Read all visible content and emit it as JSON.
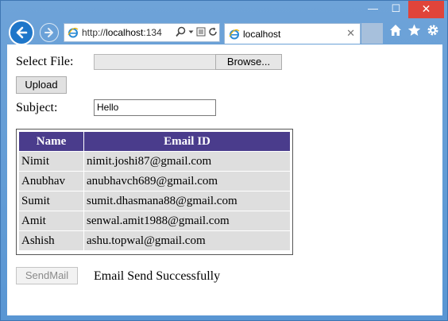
{
  "window": {
    "min_glyph": "—",
    "max_glyph": "☐",
    "close_glyph": "✕"
  },
  "browser": {
    "address_prefix": "http://",
    "address_host": "localhost",
    "address_rest": ":134",
    "tab_title": "localhost",
    "tab_close_glyph": "✕",
    "icons": [
      "back-arrow-icon",
      "forward-arrow-icon",
      "ie-logo-icon",
      "search-icon",
      "dropdown-icon",
      "compatibility-icon",
      "refresh-icon",
      "home-icon",
      "favorites-star-icon",
      "settings-gear-icon"
    ]
  },
  "form": {
    "select_file_label": "Select File:",
    "browse_label": "Browse...",
    "upload_label": "Upload",
    "subject_label": "Subject:",
    "subject_value": "Hello",
    "sendmail_label": "SendMail",
    "status_message": "Email Send Successfully"
  },
  "table": {
    "headers": [
      "Name",
      "Email ID"
    ],
    "rows": [
      [
        "Nimit",
        "nimit.joshi87@gmail.com"
      ],
      [
        "Anubhav",
        "anubhavch689@gmail.com"
      ],
      [
        "Sumit",
        "sumit.dhasmana88@gmail.com"
      ],
      [
        "Amit",
        "senwal.amit1988@gmail.com"
      ],
      [
        "Ashish",
        "ashu.topwal@gmail.com"
      ]
    ]
  },
  "colors": {
    "header_bg": "#4a3c8c",
    "row_bg": "#dedede",
    "titlebar": "#5b9bd5",
    "close_red": "#e0443a"
  }
}
